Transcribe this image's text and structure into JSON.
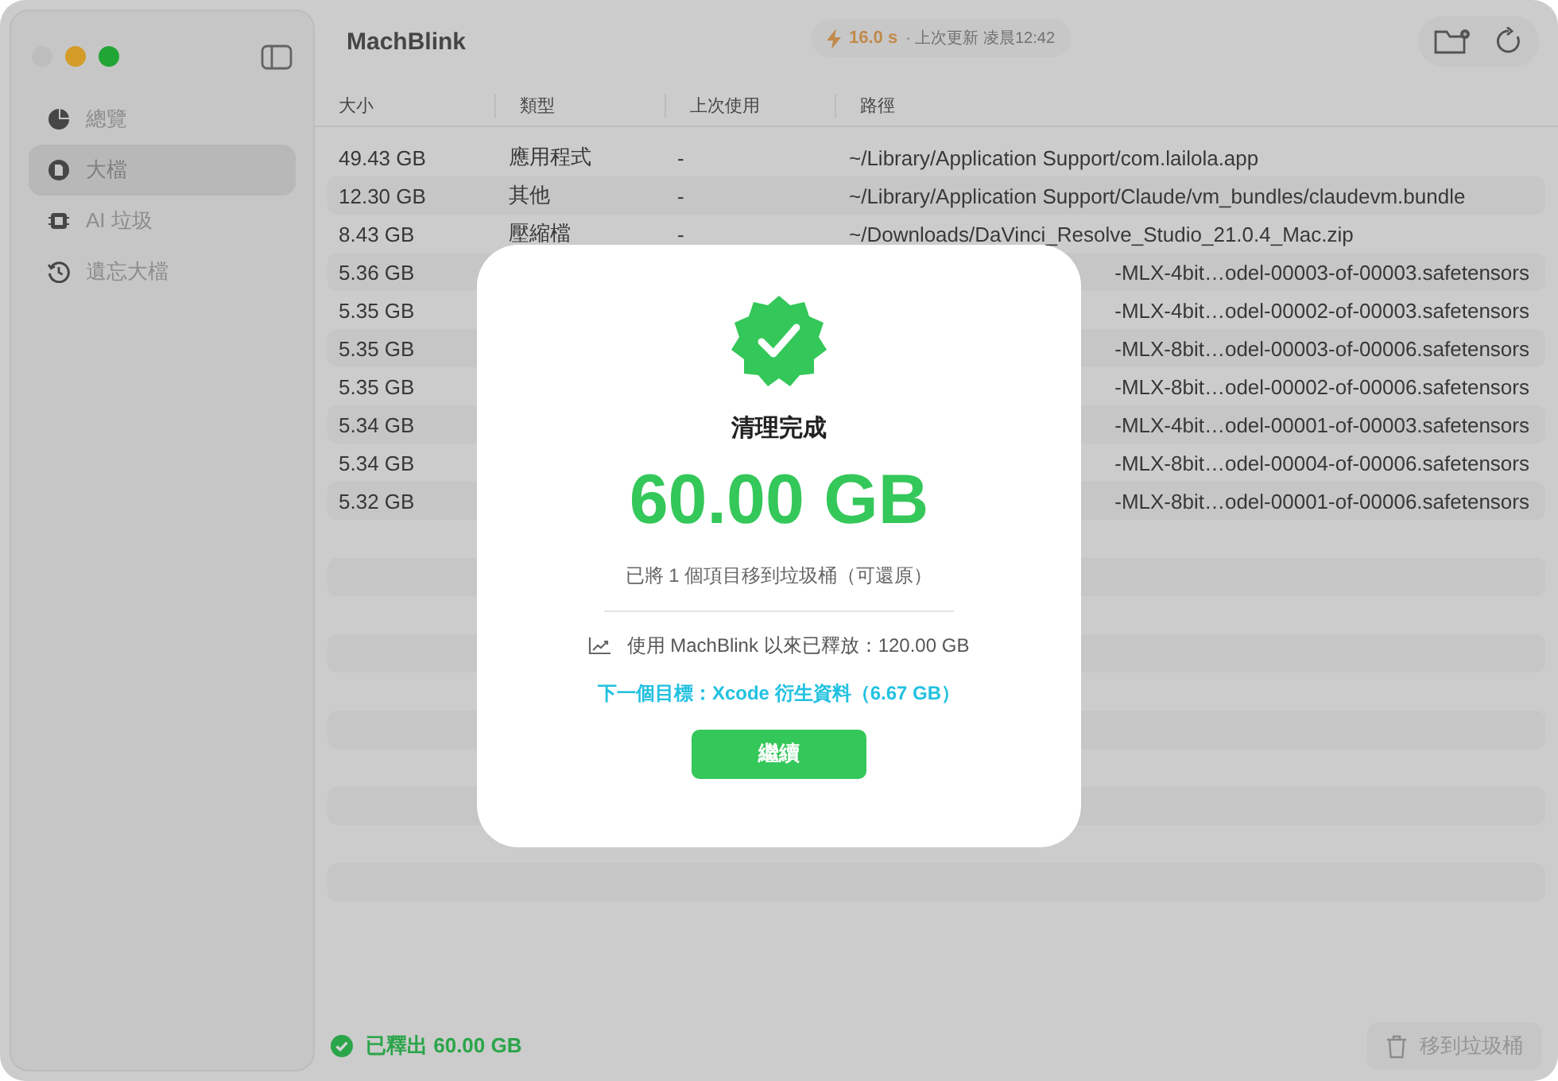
{
  "window": {
    "title": "MachBlink"
  },
  "status_pill": {
    "duration": "16.0 s",
    "updated": "· 上次更新 凌晨12:42"
  },
  "sidebar": {
    "items": [
      {
        "label": "總覽",
        "kind": "pie",
        "selected": false
      },
      {
        "label": "大檔",
        "kind": "file",
        "selected": true
      },
      {
        "label": "AI 垃圾",
        "kind": "chip",
        "selected": false
      },
      {
        "label": "遺忘大檔",
        "kind": "history",
        "selected": false
      }
    ]
  },
  "table": {
    "columns": [
      "大小",
      "類型",
      "上次使用",
      "路徑"
    ],
    "rows": [
      {
        "size": "49.43 GB",
        "type": "應用程式",
        "last_used": "-",
        "path": "~/Library/Application Support/com.lailola.app"
      },
      {
        "size": "12.30 GB",
        "type": "其他",
        "last_used": "-",
        "path": "~/Library/Application Support/Claude/vm_bundles/claudevm.bundle"
      },
      {
        "size": "8.43 GB",
        "type": "壓縮檔",
        "last_used": "-",
        "path": "~/Downloads/DaVinci_Resolve_Studio_21.0.4_Mac.zip"
      },
      {
        "size": "5.36 GB",
        "path": "-MLX-4bit…odel-00003-of-00003.safetensors"
      },
      {
        "size": "5.35 GB",
        "path": "-MLX-4bit…odel-00002-of-00003.safetensors"
      },
      {
        "size": "5.35 GB",
        "path": "-MLX-8bit…odel-00003-of-00006.safetensors"
      },
      {
        "size": "5.35 GB",
        "path": "-MLX-8bit…odel-00002-of-00006.safetensors"
      },
      {
        "size": "5.34 GB",
        "path": "-MLX-4bit…odel-00001-of-00003.safetensors"
      },
      {
        "size": "5.34 GB",
        "path": "-MLX-8bit…odel-00004-of-00006.safetensors"
      },
      {
        "size": "5.32 GB",
        "path": "-MLX-8bit…odel-00001-of-00006.safetensors"
      }
    ]
  },
  "footer": {
    "freed": "已釋出 60.00 GB",
    "trash_button": {
      "label": "移到垃圾桶",
      "disabled": true
    }
  },
  "dialog": {
    "title": "清理完成",
    "amount": "60.00 GB",
    "message": "已將 1 個項目移到垃圾桶（可還原）",
    "lifetime": "使用 MachBlink 以來已釋放：120.00 GB",
    "next_target": "下一個目標：Xcode 衍生資料（6.67 GB）",
    "button": "繼續"
  }
}
